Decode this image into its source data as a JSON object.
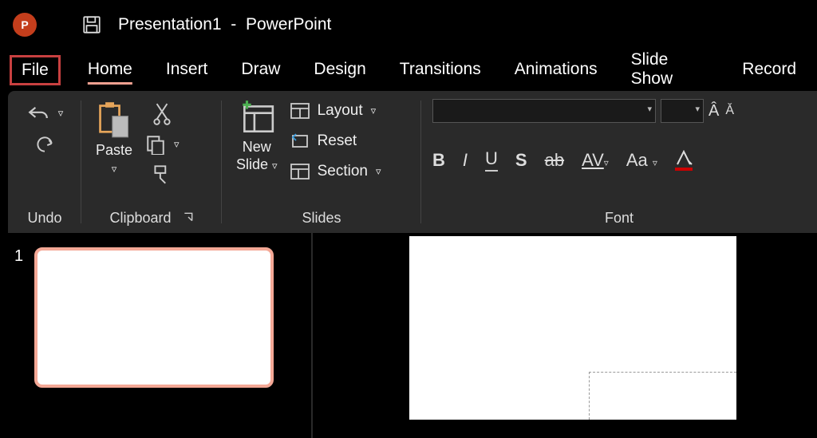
{
  "title": {
    "document": "Presentation1",
    "appsep": "-",
    "app": "PowerPoint"
  },
  "tabs": {
    "file": "File",
    "home": "Home",
    "insert": "Insert",
    "draw": "Draw",
    "design": "Design",
    "transitions": "Transitions",
    "animations": "Animations",
    "slideshow": "Slide Show",
    "record": "Record"
  },
  "ribbon": {
    "undo": {
      "label": "Undo"
    },
    "clipboard": {
      "label": "Clipboard",
      "paste": "Paste"
    },
    "slides": {
      "label": "Slides",
      "newslide_line1": "New",
      "newslide_line2": "Slide",
      "layout": "Layout",
      "reset": "Reset",
      "section": "Section"
    },
    "font": {
      "label": "Font",
      "increase": "A",
      "decrease": "A",
      "bold": "B",
      "italic": "I",
      "underline": "U",
      "shadow": "S",
      "strike": "ab",
      "spacing": "AV",
      "case": "Aa"
    }
  },
  "slide": {
    "number": "1"
  }
}
